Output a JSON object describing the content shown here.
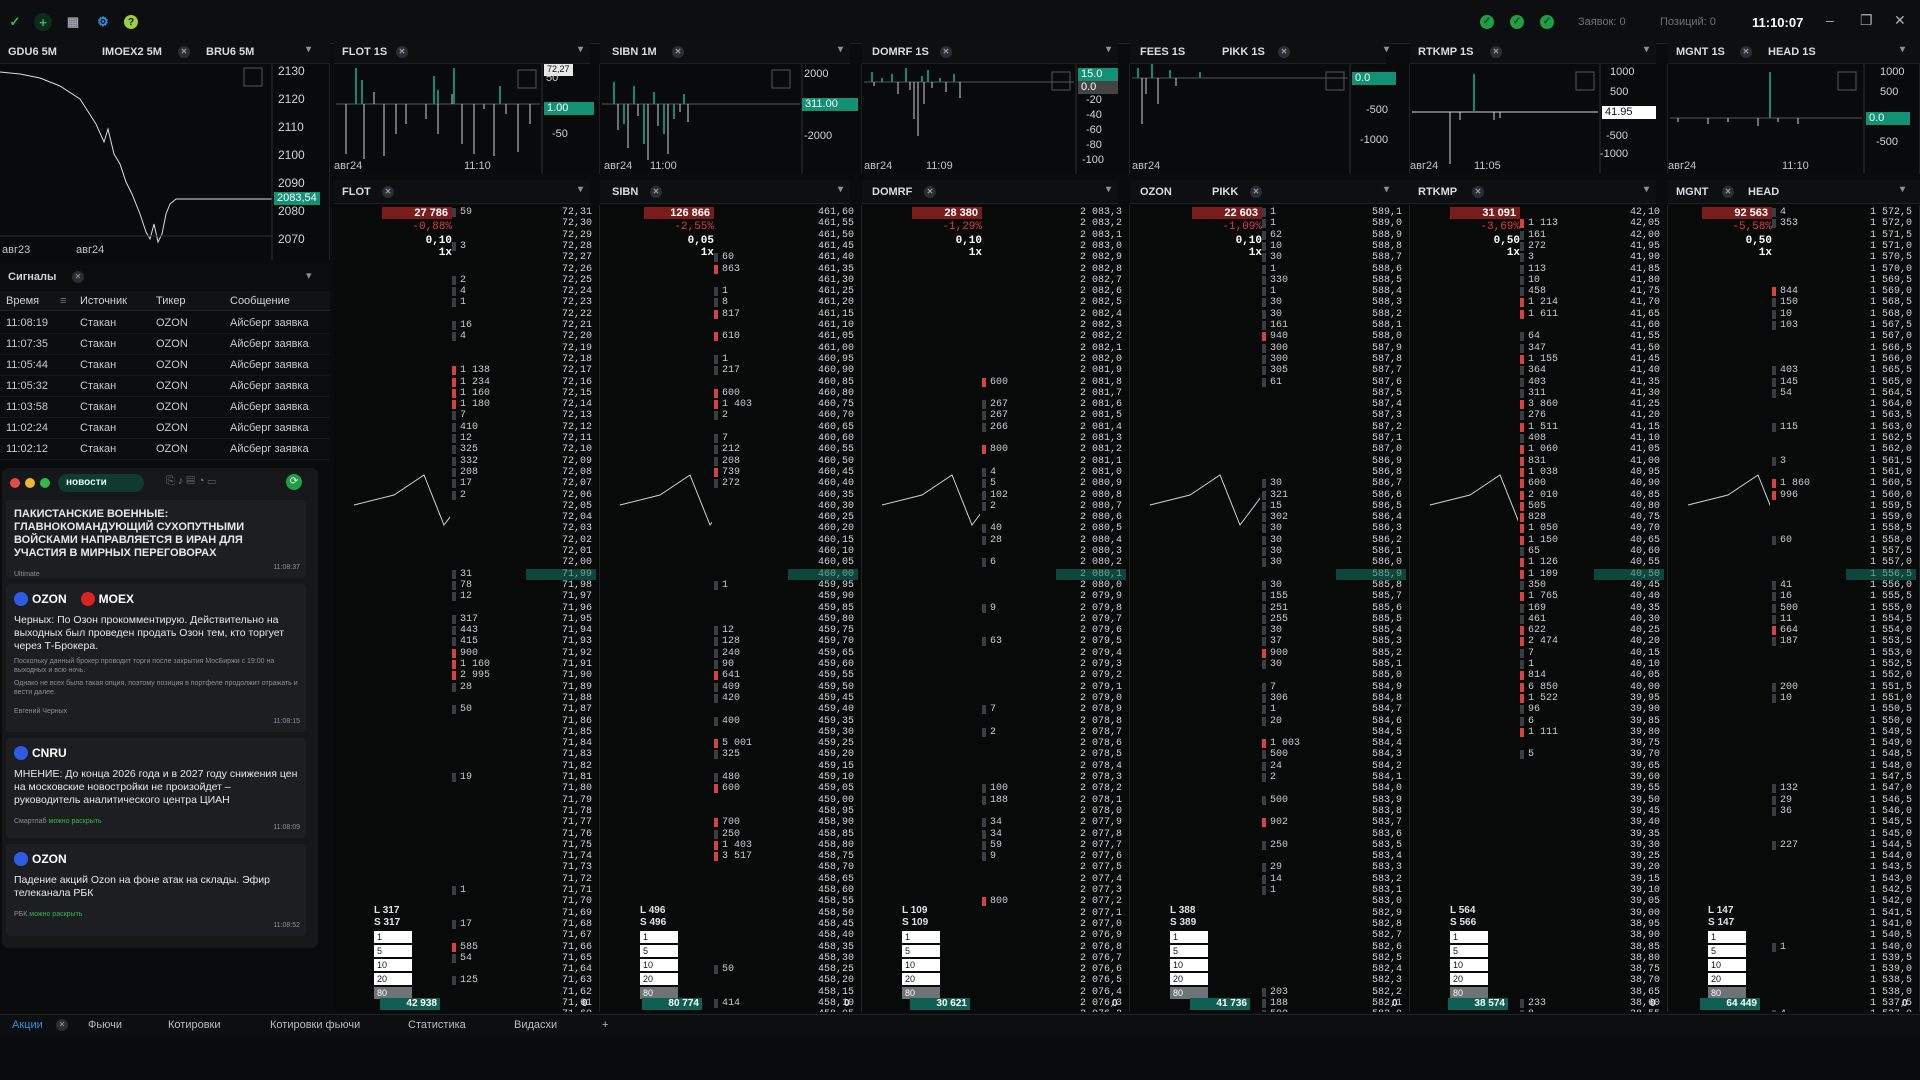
{
  "topbar": {
    "time": "11:10:07",
    "orders": "Заявок: 0",
    "positions": "Позиций: 0"
  },
  "panels_top": [
    {
      "tab": "GDU6 5M",
      "ylabels": [
        "2130",
        "2120",
        "2110",
        "2100",
        "2090",
        "2080",
        "2070"
      ],
      "badge": "2083,54",
      "xlabels": [
        "авг23",
        "авг24"
      ]
    },
    {
      "tab": "IMOEX2 5M"
    },
    {
      "tab": "BRU6 5M"
    },
    {
      "tab": "FLOT 1S",
      "ylabels": [
        "50",
        "-50"
      ],
      "badge": "1.00",
      "badge2": "72,27",
      "xlabels": [
        "авг24",
        "11:10"
      ]
    },
    {
      "tab": "SIBN 1M",
      "ylabels": [
        "2000",
        "-2000"
      ],
      "badge": "311.00",
      "xlabels": [
        "авг24",
        "11:00"
      ]
    },
    {
      "tab": "DOMRF 1S",
      "ylabels": [
        "20",
        "0",
        "-20",
        "-40",
        "-60",
        "-80",
        "-100"
      ],
      "badge": "15.0",
      "badge2": "0.0",
      "xlabels": [
        "авг24",
        "11:09"
      ]
    },
    {
      "tab": "FEES 1S"
    },
    {
      "tab": "PIKK 1S",
      "ylabels": [
        "-500",
        "-1000"
      ],
      "badge": "0.0",
      "xlabels": [
        "авг24"
      ]
    },
    {
      "tab": "RTKMP 1S",
      "ylabels": [
        "1000",
        "500",
        "0",
        "-500",
        "-1000"
      ],
      "badge": "41.95",
      "xlabels": [
        "авг24",
        "11:05"
      ]
    },
    {
      "tab": "MGNT 1S"
    },
    {
      "tab": "HEAD 1S",
      "ylabels": [
        "1000",
        "500",
        "0.0",
        "-500"
      ],
      "badge": "0.0",
      "xlabels": [
        "авг24",
        "11:10"
      ]
    }
  ],
  "books": [
    {
      "tab": "FLOT",
      "top": "27 786",
      "pct": "-0,88%",
      "step": "0,10",
      "mult": "1x",
      "L": "L 317",
      "S": "S 317",
      "total": "42 938",
      "zero": "0",
      "prices": [
        "72,31",
        "72,30",
        "72,29",
        "72,28",
        "72,27",
        "72,26",
        "72,25",
        "72,24",
        "72,23",
        "72,22",
        "72,21",
        "72,20",
        "72,19",
        "72,18",
        "72,17",
        "72,16",
        "72,15",
        "72,14",
        "72,13",
        "72,12",
        "72,11",
        "72,10",
        "72,09",
        "72,08",
        "72,07",
        "72,06",
        "72,05",
        "72,04",
        "72,03",
        "72,02",
        "72,01",
        "72,00",
        "71,99",
        "71,98",
        "71,97",
        "71,96",
        "71,95",
        "71,94",
        "71,93",
        "71,92",
        "71,91",
        "71,90",
        "71,89",
        "71,88",
        "71,87",
        "71,86",
        "71,85",
        "71,84",
        "71,83",
        "71,82",
        "71,81",
        "71,80",
        "71,79",
        "71,78",
        "71,77",
        "71,76",
        "71,75",
        "71,74",
        "71,73",
        "71,72",
        "71,71",
        "71,70",
        "71,69",
        "71,68",
        "71,67",
        "71,66",
        "71,65",
        "71,64",
        "71,63",
        "71,62",
        "71,61",
        "71,60"
      ],
      "vols": [
        "59",
        "",
        "",
        "3",
        "",
        "",
        "2",
        "4",
        "1",
        "",
        "16",
        "4",
        "",
        "",
        "1 138",
        "1 234",
        "1 160",
        "1 180",
        "7",
        "410",
        "12",
        "325",
        "332",
        "208",
        "17",
        "2",
        "",
        "",
        "",
        "",
        "",
        "",
        "31",
        "78",
        "12",
        "",
        "317",
        "443",
        "415",
        "900",
        "1 160",
        "2 995",
        "28",
        "",
        "50",
        "",
        "",
        "",
        "",
        "",
        "19",
        "",
        "",
        "",
        "",
        "",
        "",
        "",
        "",
        "",
        "1",
        "",
        "",
        "17",
        "",
        "585",
        "54",
        "",
        "125",
        "",
        "",
        ""
      ]
    },
    {
      "tab": "SIBN",
      "top": "126 866",
      "pct": "-2,55%",
      "step": "0,05",
      "mult": "1x",
      "L": "L 496",
      "S": "S 496",
      "total": "80 774",
      "zero": "0",
      "prices": [
        "461,60",
        "461,55",
        "461,50",
        "461,45",
        "461,40",
        "461,35",
        "461,30",
        "461,25",
        "461,20",
        "461,15",
        "461,10",
        "461,05",
        "461,00",
        "460,95",
        "460,90",
        "460,85",
        "460,80",
        "460,75",
        "460,70",
        "460,65",
        "460,60",
        "460,55",
        "460,50",
        "460,45",
        "460,40",
        "460,35",
        "460,30",
        "460,25",
        "460,20",
        "460,15",
        "460,10",
        "460,05",
        "460,00",
        "459,95",
        "459,90",
        "459,85",
        "459,80",
        "459,75",
        "459,70",
        "459,65",
        "459,60",
        "459,55",
        "459,50",
        "459,45",
        "459,40",
        "459,35",
        "459,30",
        "459,25",
        "459,20",
        "459,15",
        "459,10",
        "459,05",
        "459,00",
        "458,95",
        "458,90",
        "458,85",
        "458,80",
        "458,75",
        "458,70",
        "458,65",
        "458,60",
        "458,55",
        "458,50",
        "458,45",
        "458,40",
        "458,35",
        "458,30",
        "458,25",
        "458,20",
        "458,15",
        "458,10",
        "458,05"
      ],
      "vols": [
        "",
        "",
        "",
        "",
        "60",
        "863",
        "",
        "1",
        "8",
        "817",
        "",
        "610",
        "",
        "1",
        "217",
        "",
        "600",
        "1 403",
        "2",
        "",
        "7",
        "212",
        "208",
        "739",
        "272",
        "",
        "",
        "",
        "",
        "",
        "",
        "",
        "",
        "1",
        "",
        "",
        "",
        "12",
        "128",
        "240",
        "90",
        "641",
        "409",
        "420",
        "",
        "400",
        "",
        "5 001",
        "325",
        "",
        "480",
        "600",
        "",
        "",
        "700",
        "250",
        "1 403",
        "3 517",
        "",
        "",
        "",
        "",
        "",
        "",
        "",
        "",
        "",
        "50",
        "",
        "",
        "414",
        ""
      ]
    },
    {
      "tab": "DOMRF",
      "top": "28 380",
      "pct": "-1,29%",
      "step": "0,10",
      "mult": "1x",
      "L": "L 109",
      "S": "S 109",
      "total": "30 621",
      "zero": "0",
      "prices": [
        "2 083,3",
        "2 083,2",
        "2 083,1",
        "2 083,0",
        "2 082,9",
        "2 082,8",
        "2 082,7",
        "2 082,6",
        "2 082,5",
        "2 082,4",
        "2 082,3",
        "2 082,2",
        "2 082,1",
        "2 082,0",
        "2 081,9",
        "2 081,8",
        "2 081,7",
        "2 081,6",
        "2 081,5",
        "2 081,4",
        "2 081,3",
        "2 081,2",
        "2 081,1",
        "2 081,0",
        "2 080,9",
        "2 080,8",
        "2 080,7",
        "2 080,6",
        "2 080,5",
        "2 080,4",
        "2 080,3",
        "2 080,2",
        "2 080,1",
        "2 080,0",
        "2 079,9",
        "2 079,8",
        "2 079,7",
        "2 079,6",
        "2 079,5",
        "2 079,4",
        "2 079,3",
        "2 079,2",
        "2 079,1",
        "2 079,0",
        "2 078,9",
        "2 078,8",
        "2 078,7",
        "2 078,6",
        "2 078,5",
        "2 078,4",
        "2 078,3",
        "2 078,2",
        "2 078,1",
        "2 078,0",
        "2 077,9",
        "2 077,8",
        "2 077,7",
        "2 077,6",
        "2 077,5",
        "2 077,4",
        "2 077,3",
        "2 077,2",
        "2 077,1",
        "2 077,0",
        "2 076,9",
        "2 076,8",
        "2 076,7",
        "2 076,6",
        "2 076,5",
        "2 076,4",
        "2 076,3",
        "2 076,2"
      ],
      "vols": [
        "",
        "",
        "",
        "",
        "",
        "",
        "",
        "",
        "",
        "",
        "",
        "",
        "",
        "",
        "",
        "600",
        "",
        "267",
        "267",
        "266",
        "",
        "800",
        "",
        "4",
        "5",
        "102",
        "2",
        "",
        "40",
        "28",
        "",
        "6",
        "",
        "",
        "",
        "9",
        "",
        "",
        "63",
        "",
        "",
        "",
        "",
        "",
        "7",
        "",
        "2",
        "",
        "",
        "",
        "",
        "100",
        "188",
        "",
        "34",
        "34",
        "59",
        "9",
        "",
        "",
        "",
        "800",
        "",
        "",
        "",
        "",
        "",
        "",
        "",
        "",
        ""
      ]
    },
    {
      "tab": "PIKK",
      "top": "22 603",
      "pct": "-1,09%",
      "step": "0,10",
      "mult": "1x",
      "L": "L 388",
      "S": "S 389",
      "total": "41 736",
      "zero": "0",
      "prices": [
        "589,1",
        "589,0",
        "588,9",
        "588,8",
        "588,7",
        "588,6",
        "588,5",
        "588,4",
        "588,3",
        "588,2",
        "588,1",
        "588,0",
        "587,9",
        "587,8",
        "587,7",
        "587,6",
        "587,5",
        "587,4",
        "587,3",
        "587,2",
        "587,1",
        "587,0",
        "586,9",
        "586,8",
        "586,7",
        "586,6",
        "586,5",
        "586,4",
        "586,3",
        "586,2",
        "586,1",
        "586,0",
        "585,9",
        "585,8",
        "585,7",
        "585,6",
        "585,5",
        "585,4",
        "585,3",
        "585,2",
        "585,1",
        "585,0",
        "584,9",
        "584,8",
        "584,7",
        "584,6",
        "584,5",
        "584,4",
        "584,3",
        "584,2",
        "584,1",
        "584,0",
        "583,9",
        "583,8",
        "583,7",
        "583,6",
        "583,5",
        "583,4",
        "583,3",
        "583,2",
        "583,1",
        "583,0",
        "582,9",
        "582,8",
        "582,7",
        "582,6",
        "582,5",
        "582,4",
        "582,3",
        "582,2",
        "582,1",
        "582,0"
      ],
      "vols": [
        "1",
        "1",
        "62",
        "10",
        "30",
        "1",
        "330",
        "1",
        "30",
        "30",
        "161",
        "940",
        "300",
        "300",
        "305",
        "61",
        "",
        "",
        "",
        "",
        "",
        "",
        "",
        "",
        "30",
        "321",
        "15",
        "302",
        "30",
        "30",
        "30",
        "30",
        "",
        "30",
        "155",
        "251",
        "255",
        "30",
        "37",
        "900",
        "30",
        "",
        "7",
        "306",
        "1",
        "20",
        "",
        "1 003",
        "500",
        "24",
        "2",
        "",
        "500",
        "",
        "902",
        "",
        "250",
        "",
        "29",
        "14",
        "1",
        "",
        "",
        "",
        "",
        "",
        "",
        "",
        "",
        "203",
        "188",
        "500"
      ]
    },
    {
      "tab": "RTKMP",
      "top": "31 091",
      "pct": "-3,69%",
      "step": "0,50",
      "mult": "1x",
      "L": "L 564",
      "S": "S 566",
      "total": "38 574",
      "zero": "0",
      "prices": [
        "42,10",
        "42,05",
        "42,00",
        "41,95",
        "41,90",
        "41,85",
        "41,80",
        "41,75",
        "41,70",
        "41,65",
        "41,60",
        "41,55",
        "41,50",
        "41,45",
        "41,40",
        "41,35",
        "41,30",
        "41,25",
        "41,20",
        "41,15",
        "41,10",
        "41,05",
        "41,00",
        "40,95",
        "40,90",
        "40,85",
        "40,80",
        "40,75",
        "40,70",
        "40,65",
        "40,60",
        "40,55",
        "40,50",
        "40,45",
        "40,40",
        "40,35",
        "40,30",
        "40,25",
        "40,20",
        "40,15",
        "40,10",
        "40,05",
        "40,00",
        "39,95",
        "39,90",
        "39,85",
        "39,80",
        "39,75",
        "39,70",
        "39,65",
        "39,60",
        "39,55",
        "39,50",
        "39,45",
        "39,40",
        "39,35",
        "39,30",
        "39,25",
        "39,20",
        "39,15",
        "39,10",
        "39,05",
        "39,00",
        "38,95",
        "38,90",
        "38,85",
        "38,80",
        "38,75",
        "38,70",
        "38,65",
        "38,60",
        "38,55"
      ],
      "vols": [
        "",
        "1 113",
        "161",
        "272",
        "3",
        "113",
        "10",
        "458",
        "1 214",
        "1 611",
        "",
        "64",
        "347",
        "1 155",
        "364",
        "403",
        "311",
        "3 860",
        "276",
        "1 511",
        "408",
        "1 060",
        "831",
        "1 038",
        "600",
        "2 010",
        "505",
        "828",
        "1 050",
        "1 150",
        "65",
        "1 126",
        "1 109",
        "350",
        "1 765",
        "169",
        "461",
        "622",
        "2 474",
        "7",
        "1",
        "814",
        "6 850",
        "1 522",
        "96",
        "6",
        "1 111",
        "",
        "5",
        "",
        "",
        "",
        "",
        "",
        "",
        "",
        "",
        "",
        "",
        "",
        "",
        "",
        "",
        "",
        "",
        "",
        "",
        "",
        "",
        "",
        "233",
        "8"
      ]
    },
    {
      "tab": "HEAD",
      "top": "92 563",
      "pct": "-5,58%",
      "step": "0,50",
      "mult": "1x",
      "L": "L 147",
      "S": "S 147",
      "total": "64 449",
      "zero": "0",
      "prices": [
        "1 572,5",
        "1 572,0",
        "1 571,5",
        "1 571,0",
        "1 570,5",
        "1 570,0",
        "1 569,5",
        "1 569,0",
        "1 568,5",
        "1 568,0",
        "1 567,5",
        "1 567,0",
        "1 566,5",
        "1 566,0",
        "1 565,5",
        "1 565,0",
        "1 564,5",
        "1 564,0",
        "1 563,5",
        "1 563,0",
        "1 562,5",
        "1 562,0",
        "1 561,5",
        "1 561,0",
        "1 560,5",
        "1 560,0",
        "1 559,5",
        "1 559,0",
        "1 558,5",
        "1 558,0",
        "1 557,5",
        "1 557,0",
        "1 556,5",
        "1 556,0",
        "1 555,5",
        "1 555,0",
        "1 554,5",
        "1 554,0",
        "1 553,5",
        "1 553,0",
        "1 552,5",
        "1 552,0",
        "1 551,5",
        "1 551,0",
        "1 550,5",
        "1 550,0",
        "1 549,5",
        "1 549,0",
        "1 548,5",
        "1 548,0",
        "1 547,5",
        "1 547,0",
        "1 546,5",
        "1 546,0",
        "1 545,5",
        "1 545,0",
        "1 544,5",
        "1 544,0",
        "1 543,5",
        "1 543,0",
        "1 542,5",
        "1 542,0",
        "1 541,5",
        "1 541,0",
        "1 540,5",
        "1 540,0",
        "1 539,5",
        "1 539,0",
        "1 538,5",
        "1 538,0",
        "1 537,5",
        "1 537,0"
      ],
      "vols": [
        "4",
        "353",
        "",
        "",
        "",
        "",
        "",
        "844",
        "150",
        "10",
        "103",
        "",
        "",
        "",
        "403",
        "145",
        "54",
        "",
        "",
        "115",
        "",
        "",
        "3",
        "",
        "1 860",
        "996",
        "",
        "",
        "",
        "60",
        "",
        "",
        "",
        "41",
        "16",
        "500",
        "11",
        "664",
        "187",
        "",
        "",
        "",
        "200",
        "10",
        "",
        "",
        "",
        "",
        "",
        "",
        "",
        "132",
        "29",
        "36",
        "",
        "",
        "227",
        "",
        "",
        "",
        "",
        "",
        "",
        "",
        "",
        "1",
        "",
        "",
        "",
        "",
        "",
        "4"
      ]
    }
  ],
  "signals": {
    "title": "Сигналы",
    "headers": [
      "Время",
      "Источник",
      "Тикер",
      "Сообщение"
    ],
    "rows": [
      [
        "11:08:19",
        "Стакан",
        "OZON",
        "Айсберг заявка"
      ],
      [
        "11:07:35",
        "Стакан",
        "OZON",
        "Айсберг заявка"
      ],
      [
        "11:05:44",
        "Стакан",
        "OZON",
        "Айсберг заявка"
      ],
      [
        "11:05:32",
        "Стакан",
        "OZON",
        "Айсберг заявка"
      ],
      [
        "11:03:58",
        "Стакан",
        "OZON",
        "Айсберг заявка"
      ],
      [
        "11:02:24",
        "Стакан",
        "OZON",
        "Айсберг заявка"
      ],
      [
        "11:02:12",
        "Стакан",
        "OZON",
        "Айсберг заявка"
      ]
    ]
  },
  "news": {
    "filter": "новости",
    "items": [
      {
        "tags": [],
        "headline": "ПАКИСТАНСКИЕ ВОЕННЫЕ: ГЛАВНОКОМАНДУЮЩИЙ СУХОПУТНЫМИ ВОЙСКАМИ НАПРАВЛЯЕТСЯ В ИРАН ДЛЯ УЧАСТИЯ В МИРНЫХ ПЕРЕГОВОРАХ",
        "source": "Ultimate",
        "time": "11:08:37"
      },
      {
        "tags": [
          "OZON",
          "MOEX"
        ],
        "headline": "Черных: По Озон прокомментирую. Действительно на выходных был проведен продать Озон тем, кто торгует через Т-Брокера.",
        "sub": "Поскольку данный брокер проводит торги после закрытия МосБиржи с 19:00 на выходных и всю ночь.",
        "sub2": "Однако не всех была такая опция, поэтому позиция в портфеле продолжит отражать и вести далее.",
        "source": "Евгений Черных",
        "time": "11:08:15"
      },
      {
        "tags": [
          "CNRU"
        ],
        "headline": "МНЕНИЕ: До конца 2026 года и в 2027 году снижения цен на московские новостройки не произойдет – руководитель аналитического центра ЦИАН",
        "source": "Смартлаб",
        "more": "можно раскрыть",
        "time": "11:08:09"
      },
      {
        "tags": [
          "OZON"
        ],
        "headline": "Падение акций Ozon на фоне атак на склады. Эфир телеканала РБК",
        "source": "РБК",
        "more": "можно раскрыть",
        "time": "11:08:52"
      }
    ]
  },
  "tabs": [
    "Акции",
    "Фьючи",
    "Котировки",
    "Котировки фьючи",
    "Статистика",
    "Видасхи",
    "+"
  ],
  "colors": {
    "green": "#138a70",
    "red": "#a32a2a",
    "bg": "#080909"
  }
}
